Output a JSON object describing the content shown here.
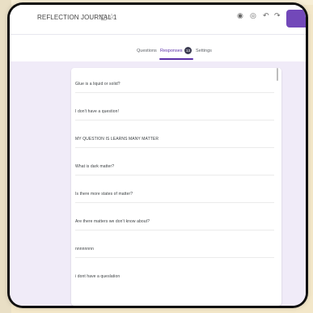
{
  "window": {
    "doc_title": "REFLECTION JOURNAL 1",
    "icons": [
      "folder-icon",
      "star-icon",
      "palette-icon",
      "eye-icon",
      "undo-icon",
      "redo-icon"
    ]
  },
  "tabs": [
    {
      "label": "Questions"
    },
    {
      "label": "Responses",
      "active": true,
      "count": "13"
    },
    {
      "label": "Settings"
    }
  ],
  "responses": [
    "Glue is a liquid or solid?",
    "I don't have a question!",
    "MY QUESTION IS LEARNS MANY MATTER",
    "What is dark matter?",
    "Is there more states of matter?",
    "Are there matters we don't know about?",
    "nnnnnnnn",
    "i dont have a queslation"
  ],
  "colors": {
    "accent": "#5b2fa8",
    "send_button": "#7248b9",
    "page_bg": "#f0ebf8"
  }
}
